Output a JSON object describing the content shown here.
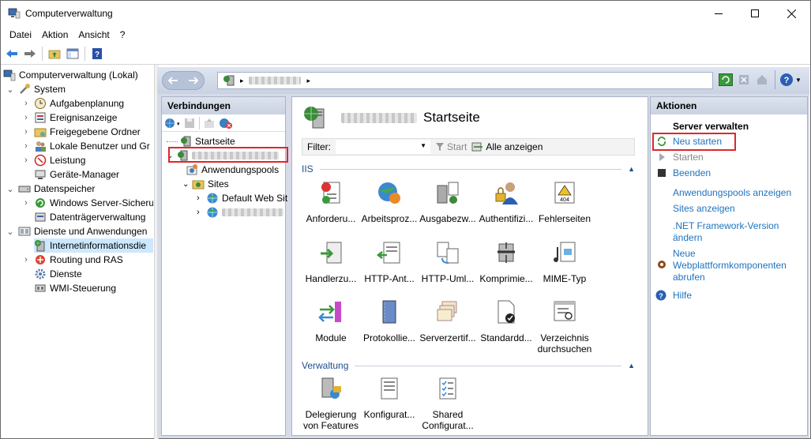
{
  "window": {
    "title": "Computerverwaltung",
    "minimize": "—",
    "maximize": "☐",
    "close": "✕"
  },
  "menu": [
    "Datei",
    "Aktion",
    "Ansicht",
    "?"
  ],
  "tree": {
    "root": "Computerverwaltung (Lokal)",
    "system": "System",
    "items_system": [
      "Aufgabenplanung",
      "Ereignisanzeige",
      "Freigegebene Ordner",
      "Lokale Benutzer und Gr",
      "Leistung",
      "Geräte-Manager"
    ],
    "storage": "Datenspeicher",
    "items_storage": [
      "Windows Server-Sicheru",
      "Datenträgerverwaltung"
    ],
    "services": "Dienste und Anwendungen",
    "items_services": [
      "Internetinformationsdie",
      "Routing und RAS",
      "Dienste",
      "WMI-Steuerung"
    ]
  },
  "iis": {
    "address_arrow": "▸",
    "connections": {
      "title": "Verbindungen",
      "start": "Startseite",
      "apppools": "Anwendungspools",
      "sites": "Sites",
      "default_site": "Default Web Sit"
    },
    "main": {
      "title": "Startseite",
      "filter_label": "Filter:",
      "start": "Start",
      "show_all": "Alle anzeigen",
      "group_iis": "IIS",
      "group_admin": "Verwaltung",
      "tiles_row1": [
        "Anforderu...",
        "Arbeitsproz...",
        "Ausgabezw...",
        "Authentifizi...",
        "Fehlerseiten"
      ],
      "tiles_row2": [
        "Handlerzu...",
        "HTTP-Ant...",
        "HTTP-Uml...",
        "Komprimie...",
        "MIME-Typ"
      ],
      "tiles_row3": [
        "Module",
        "Protokollie...",
        "Serverzertif...",
        "Standardd...",
        "Verzeichnis durchsuchen"
      ],
      "tiles_admin": [
        "Delegierung von Features",
        "Konfigurat...",
        "Shared Configurat..."
      ]
    },
    "actions": {
      "title": "Aktionen",
      "header": "Server verwalten",
      "restart": "Neu starten",
      "start": "Starten",
      "stop": "Beenden",
      "show_apppools": "Anwendungspools anzeigen",
      "show_sites": "Sites anzeigen",
      "net_version": ".NET Framework-Version ändern",
      "web_platform": "Neue Webplattformkomponenten abrufen",
      "help": "Hilfe"
    }
  },
  "colors": {
    "accent": "#1e73be",
    "highlight": "#e0262a",
    "selection": "#cce8ff"
  }
}
